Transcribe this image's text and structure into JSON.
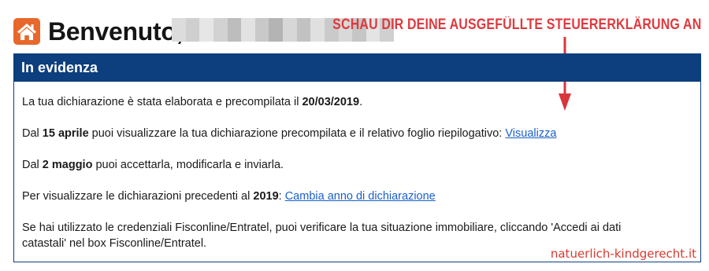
{
  "header": {
    "greeting": "Benvenuto,",
    "icon": "home-icon",
    "icon_color": "#e8672a"
  },
  "annotation": {
    "text": "SCHAU DIR DEINE AUSGEFÜLLTE STEUERERKLÄRUNG AN",
    "color": "#e0393e"
  },
  "panel": {
    "title": "In evidenza",
    "header_color": "#0d3e7d",
    "p1": {
      "text1": "La tua dichiarazione è stata elaborata e precompilata il ",
      "bold": "20/03/2019",
      "text2": "."
    },
    "p2": {
      "text1": "Dal ",
      "bold": "15 aprile",
      "text2": " puoi visualizzare la tua dichiarazione precompilata e il relativo foglio riepilogativo: ",
      "link": "Visualizza"
    },
    "p3": {
      "text1": "Dal ",
      "bold": "2 maggio",
      "text2": " puoi accettarla, modificarla e inviarla."
    },
    "p4": {
      "text1": "Per visualizzare le dichiarazioni precedenti al ",
      "bold": "2019",
      "text2": ": ",
      "link": "Cambia anno di dichiarazione"
    },
    "p5": {
      "line1": "Se hai utilizzato le credenziali Fisconline/Entratel, puoi verificare la tua situazione immobiliare, cliccando 'Accedi ai dati",
      "line2": "catastali' nel box Fisconline/Entratel."
    },
    "link_color": "#1a5fc9"
  },
  "watermark": "natuerlich-kindgerecht.it"
}
